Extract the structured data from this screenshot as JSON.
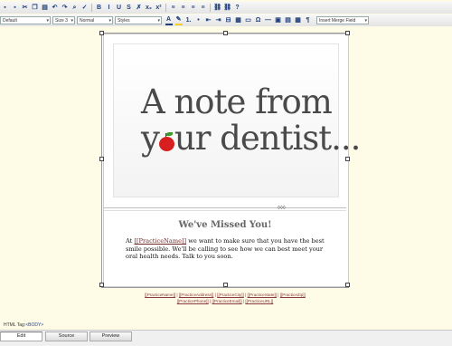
{
  "toolbar": {
    "row1_icons": [
      "save-icon",
      "print-icon",
      "cut-icon",
      "copy-icon",
      "paste-icon",
      "undo-icon",
      "redo-icon",
      "find-icon",
      "spellcheck-icon",
      "bold-icon",
      "italic-icon",
      "underline-icon",
      "strikethrough-icon",
      "remove-format-icon",
      "subscript-icon",
      "superscript-icon",
      "align-left-icon",
      "align-center-icon",
      "align-right-icon",
      "justify-icon",
      "link-icon",
      "unlink-icon",
      "help-icon"
    ],
    "row1_glyphs": [
      "▪",
      "▪",
      "✂",
      "❐",
      "▤",
      "↶",
      "↷",
      "⌕",
      "✓",
      "B",
      "I",
      "U",
      "S",
      "✗",
      "x₂",
      "x²",
      "≡",
      "≡",
      "≡",
      "≡",
      "⛓",
      "⛓",
      "?"
    ],
    "font_select": "Default",
    "size_select": "Size 3",
    "format_select": "Normal",
    "styles_select": "Styles",
    "merge_field_select": "Insert Merge Field",
    "row2_glyphs": [
      "A",
      "✎",
      "1.",
      "•",
      "⇤",
      "⇥",
      "⊟",
      "▦",
      "▭",
      "Ω",
      "—",
      "▣",
      "▤",
      "▦",
      "¶"
    ],
    "font_color": "#1f3f7a",
    "highlight_color": "#f2d02a"
  },
  "document": {
    "hero_line1": "A note from",
    "hero_line2_prefix": "y",
    "hero_line2_suffix": "ur dentist...",
    "heading": "We've Missed You!",
    "message_prefix": "At ",
    "practice_name_field": "[[PracticeName]]",
    "message_suffix": " we want to make sure that you have the best smile possible. We'll be calling to see how we can best meet your oral health needs. Talk to you soon.",
    "divider_handle": "◊◊◊"
  },
  "footer": {
    "line1": [
      "[[PracticeName]]",
      "[[PracticeAddress]]",
      "[[PracticeCity]]",
      "[[PracticeState]]",
      "[[PracticeZip]]"
    ],
    "line2": [
      "[[PracticePhone]]",
      "[[PracticeEmail]]",
      "[[PracticeURL]]"
    ],
    "separator": " | "
  },
  "status": {
    "label": "HTML Tag:",
    "tag": "<BODY>"
  },
  "tabs": [
    {
      "label": "Edit",
      "active": true
    },
    {
      "label": "Source",
      "active": false
    },
    {
      "label": "Preview",
      "active": false
    }
  ],
  "colors": {
    "background": "#fdfbe6",
    "apple": "#d81f1f",
    "merge_field": "#8a3a3a"
  }
}
